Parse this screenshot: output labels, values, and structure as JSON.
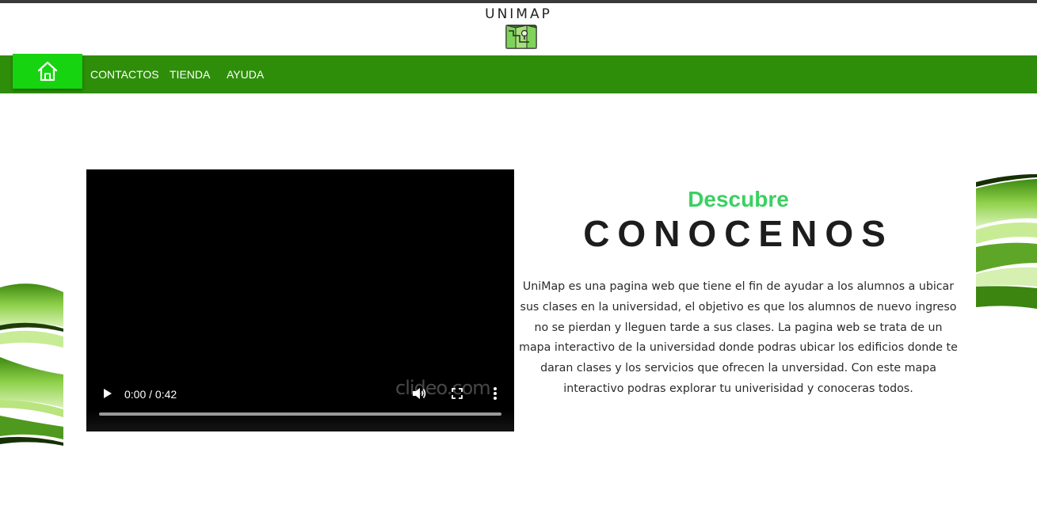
{
  "header": {
    "brand": "UNIMAP",
    "logo_icon": "map-icon"
  },
  "nav": {
    "home_icon": "home-icon",
    "links": [
      {
        "label": "CONTACTOS"
      },
      {
        "label": "TIENDA"
      },
      {
        "label": "AYUDA"
      }
    ]
  },
  "video": {
    "time": "0:00 / 0:42",
    "watermark": "clideo.com",
    "progress": 0,
    "icons": [
      "play-icon",
      "volume-icon",
      "fullscreen-icon",
      "more-options-icon"
    ]
  },
  "about": {
    "eyebrow": "Descubre",
    "title": "CONOCENOS",
    "body": "UniMap es una pagina web que tiene el fin de ayudar a los alumnos a ubicar sus clases en la universidad, el objetivo es que los alumnos de nuevo ingreso no se pierdan y lleguen tarde a sus clases. La pagina web se trata de un mapa interactivo de la universidad donde podras ubicar los edificios donde te daran clases y los servicios que ofrecen la unversidad. Con este mapa interactivo podras explorar tu univerisidad y conoceras todos."
  },
  "colors": {
    "nav_bg": "#2e8e0a",
    "home_button": "#16d40f",
    "accent_green": "#3ccf62",
    "title_dark": "#1d1d1d"
  }
}
